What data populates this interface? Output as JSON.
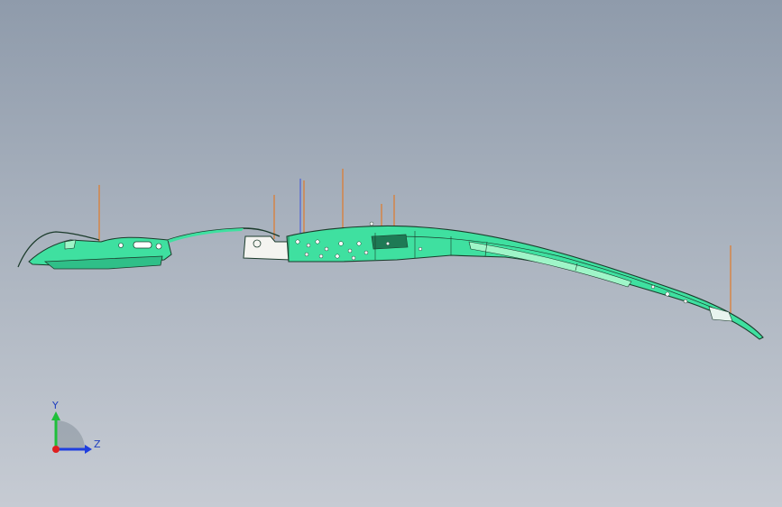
{
  "viewport": {
    "background_top": "#8f9bab",
    "background_bottom": "#c6cbd3"
  },
  "model": {
    "part_color": "#3fe0a0",
    "edge_color": "#1b3b2b",
    "highlight_color": "#9ff5c8",
    "reference_line_color": "#e07a2a"
  },
  "triad": {
    "y_label": "Y",
    "z_label": "Z",
    "y_color": "#1fbf3a",
    "z_color": "#1f3fdf",
    "x_color": "#df1f1f"
  }
}
